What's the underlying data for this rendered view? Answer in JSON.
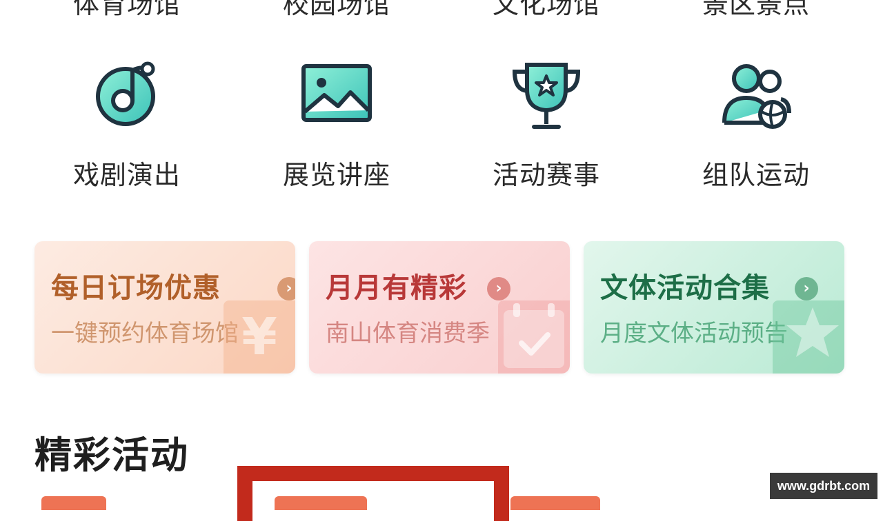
{
  "categories_top": [
    "体育场馆",
    "校园场馆",
    "文化场馆",
    "景区景点"
  ],
  "categories": [
    {
      "label": "戏剧演出",
      "icon": "music-note-icon"
    },
    {
      "label": "展览讲座",
      "icon": "picture-icon"
    },
    {
      "label": "活动赛事",
      "icon": "trophy-icon"
    },
    {
      "label": "组队运动",
      "icon": "team-icon"
    }
  ],
  "promo_cards": [
    {
      "title": "每日订场优惠",
      "subtitle": "一键预约体育场馆",
      "icon": "yen-icon",
      "accent": "#b1602a"
    },
    {
      "title": "月月有精彩",
      "subtitle": "南山体育消费季",
      "icon": "calendar-check-icon",
      "accent": "#b83838"
    },
    {
      "title": "文体活动合集",
      "subtitle": "月度文体活动预告",
      "icon": "star-icon",
      "accent": "#1d6e47"
    }
  ],
  "section": {
    "title": "精彩活动"
  },
  "watermark": "www.gdrbt.com",
  "colors": {
    "icon_teal": "#5fd6c2",
    "icon_outline": "#1f3340",
    "highlight_red": "#c22a1c",
    "tag_orange": "#ee7354"
  }
}
